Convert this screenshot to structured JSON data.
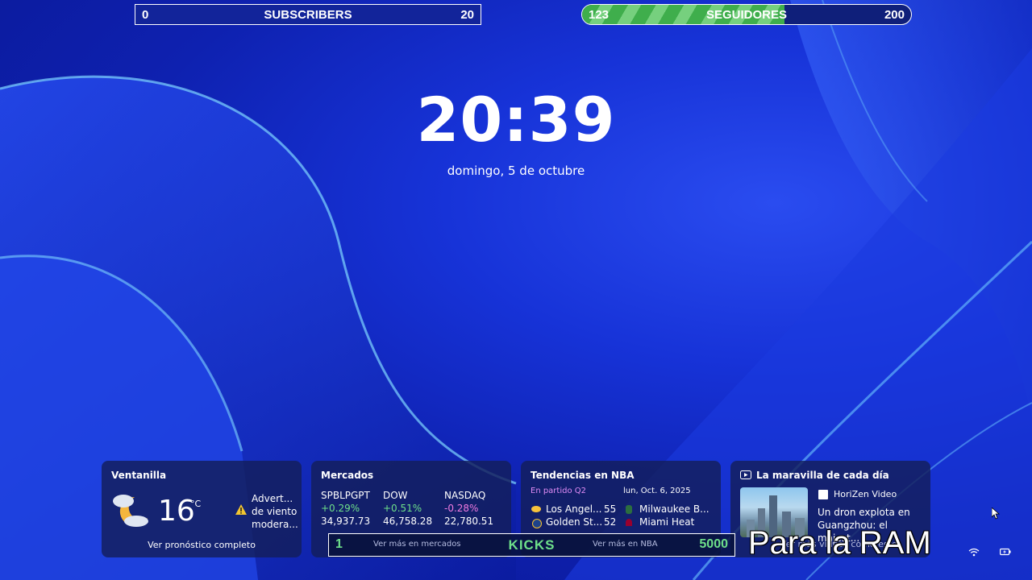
{
  "subscribers": {
    "min": "0",
    "label": "SUBSCRIBERS",
    "max": "20"
  },
  "seguidores": {
    "current": "123",
    "label": "SEGUIDORES",
    "max": "200",
    "progress": 0.615
  },
  "lock": {
    "time": "20:39",
    "date": "domingo, 5 de octubre"
  },
  "weather": {
    "title": "Ventanilla",
    "temp": "16",
    "unit": "°C",
    "alert": [
      "Advert...",
      "de viento",
      "modera..."
    ],
    "link": "Ver pronóstico completo"
  },
  "markets": {
    "title": "Mercados",
    "items": [
      {
        "name": "SPBLPGPT",
        "change": "+0.29%",
        "value": "34,937.73"
      },
      {
        "name": "DOW",
        "change": "+0.51%",
        "value": "46,758.28"
      },
      {
        "name": "NASDAQ",
        "change": "-0.28%",
        "value": "22,780.51"
      }
    ]
  },
  "nba": {
    "title": "Tendencias en NBA",
    "status": "En partido Q2",
    "date": "lun, Oct. 6, 2025",
    "team1": "Los Angel...",
    "score1": "55",
    "team2": "Golden St...",
    "score2": "52",
    "team3": "Milwaukee B...",
    "team4": "Miami Heat"
  },
  "news": {
    "title": "La maravilla de cada día",
    "source": "HoriZen Video",
    "headline": [
      "Un dron explota en",
      "Guangzhou: el majest..."
    ],
    "link": "Ver más vídeos como este"
  },
  "kicks": {
    "left": "1",
    "label": "KICKS",
    "right": "5000",
    "link_left": "Ver más en mercados",
    "link_right": "Ver más en NBA"
  },
  "overlay_text": "Para la RAM",
  "colors": {
    "positive": "#6ee08a",
    "negative": "#f07ae0",
    "accent_bg": "#1733d8"
  }
}
